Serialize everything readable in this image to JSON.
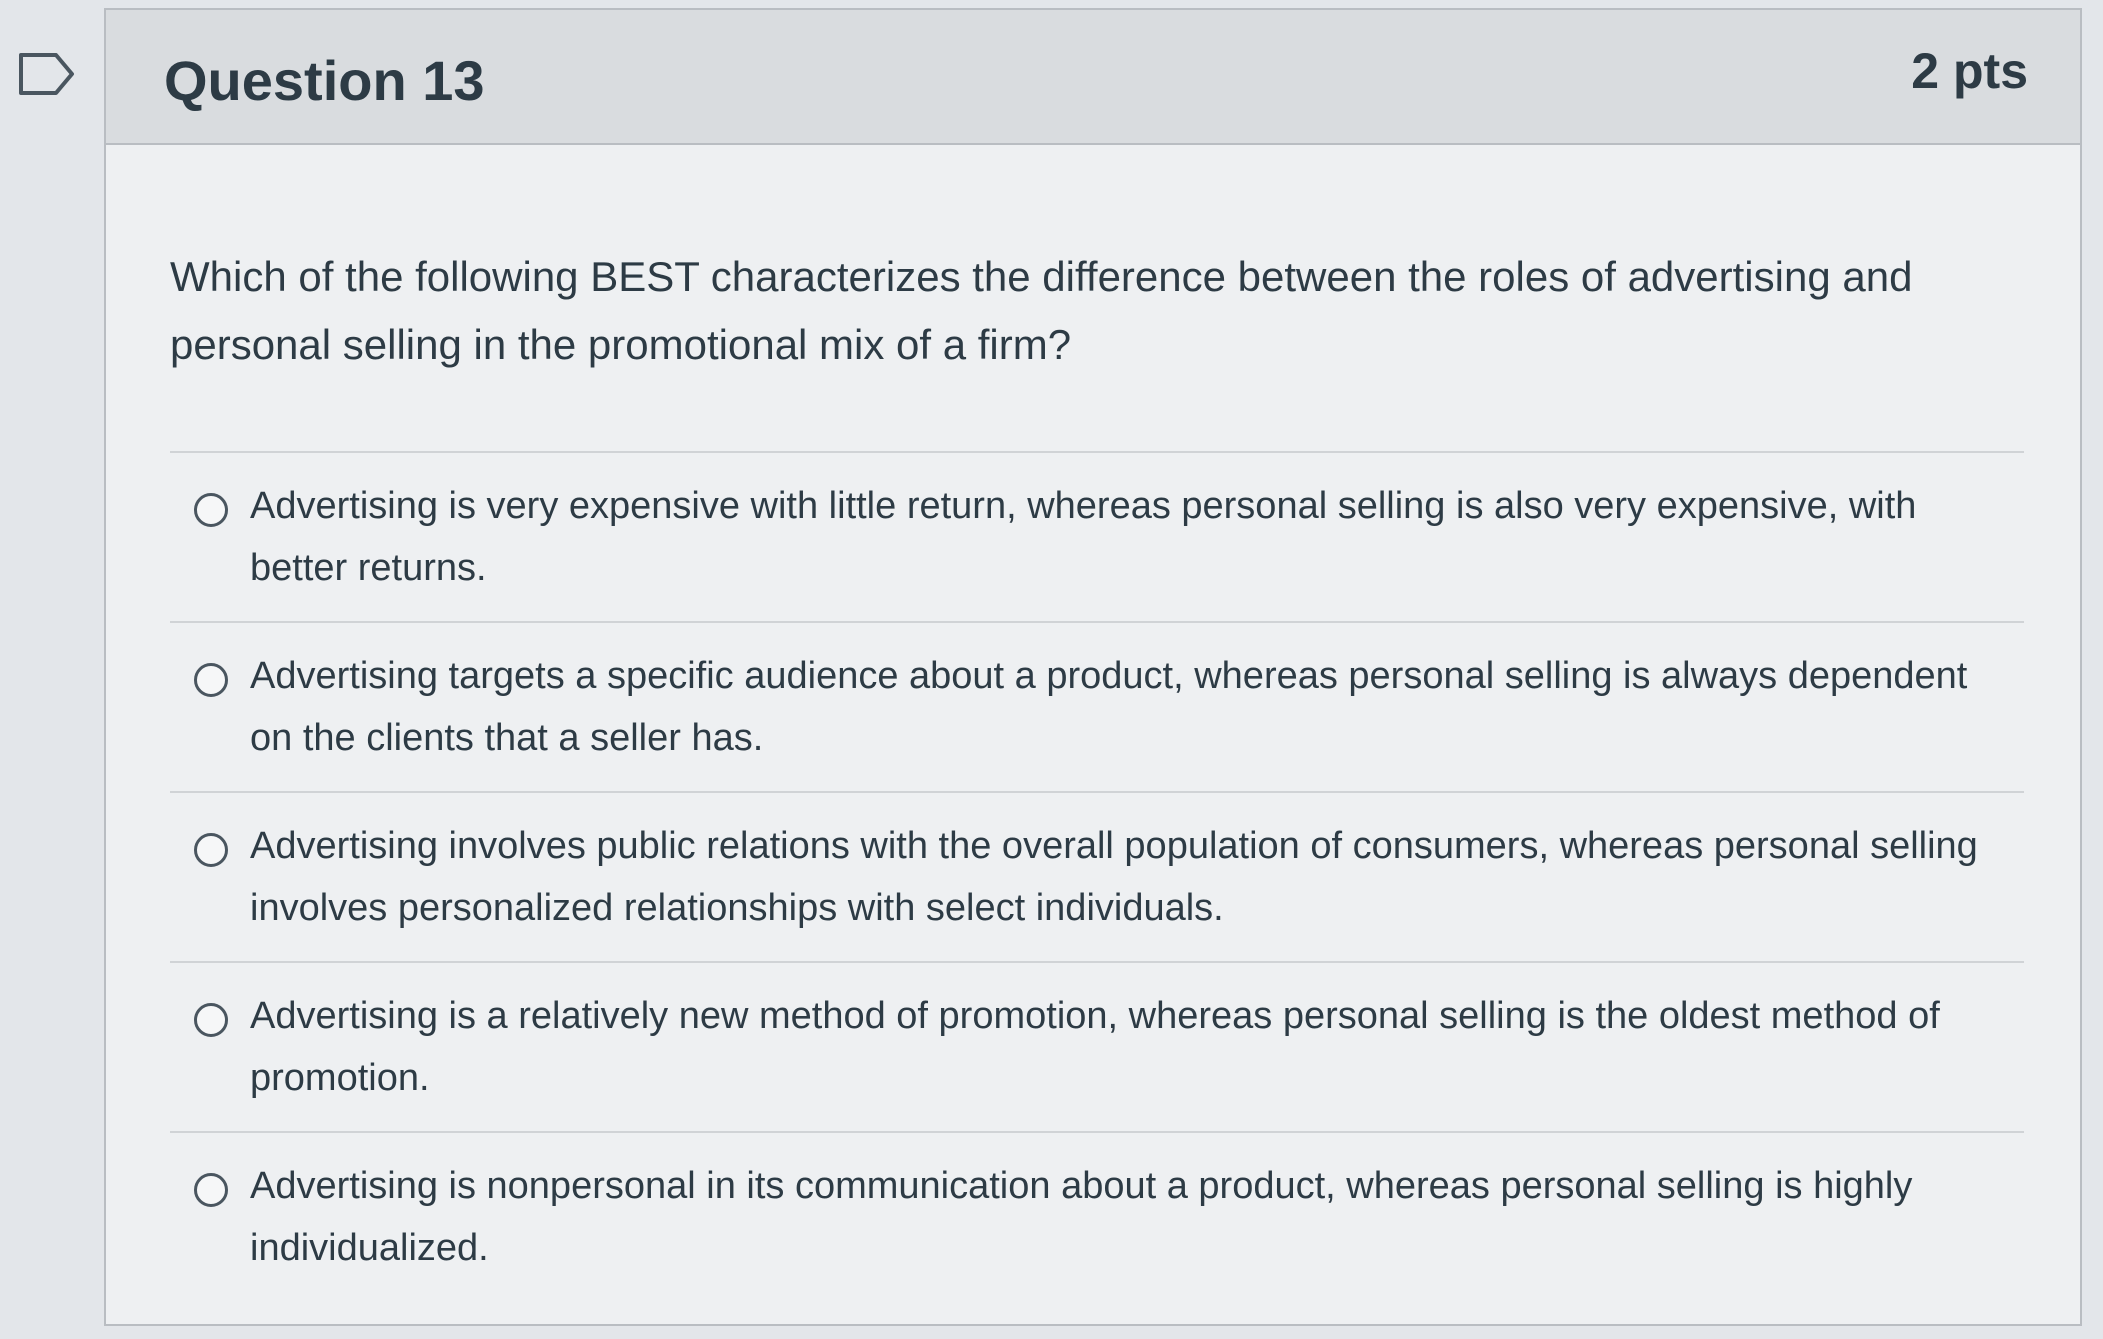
{
  "question": {
    "title": "Question 13",
    "points": "2 pts",
    "flag_icon": "bookmark-flag-icon",
    "text": "Which of the following BEST characterizes the difference between the roles of advertising and personal selling in the promotional mix of a firm?"
  },
  "answers": [
    {
      "label": "Advertising is very expensive with little return, whereas personal selling is also very expensive, with better returns.",
      "selected": false
    },
    {
      "label": "Advertising targets a specific audience about a product, whereas personal selling is always dependent on the clients that a seller has.",
      "selected": false
    },
    {
      "label": "Advertising involves public relations with the overall population of consumers, whereas personal selling involves personalized relationships with select individuals.",
      "selected": false
    },
    {
      "label": "Advertising is a relatively new method of promotion, whereas personal selling is the oldest method of promotion.",
      "selected": false
    },
    {
      "label": "Advertising is nonpersonal in its communication about a product, whereas personal selling is highly individualized.",
      "selected": false
    }
  ],
  "colors": {
    "text": "#2d3b45",
    "header_bg": "#d9dcdf",
    "border": "#b9bdc2"
  }
}
